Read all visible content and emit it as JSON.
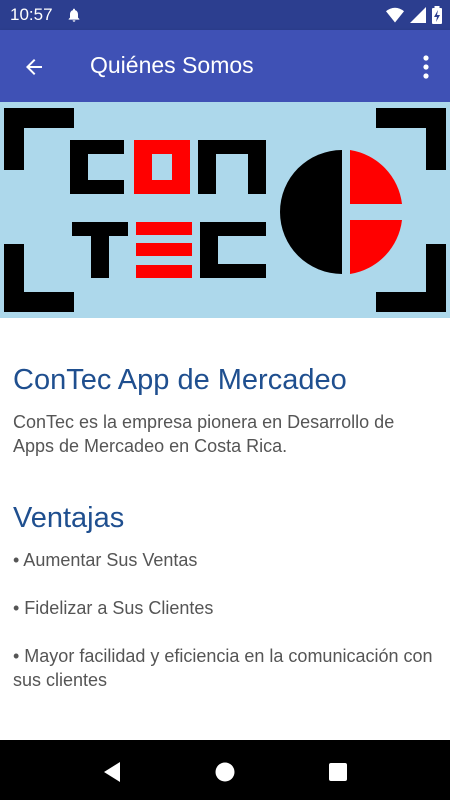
{
  "status_bar": {
    "time": "10:57",
    "icons": [
      "notification-bell-icon",
      "wifi-icon",
      "signal-icon",
      "battery-charging-icon"
    ]
  },
  "app_bar": {
    "title": "Quiénes Somos",
    "back_icon": "arrow-back-icon",
    "menu_icon": "more-vert-icon"
  },
  "banner": {
    "logo_text_top": "CON",
    "logo_text_bottom": "TEC",
    "colors": {
      "background": "#add8eb",
      "black": "#000000",
      "red": "#ff0000"
    }
  },
  "content": {
    "heading": "ConTec App de Mercadeo",
    "intro": "ConTec es la empresa pionera en Desarrollo de Apps de Mercadeo en Costa Rica.",
    "advantages_heading": "Ventajas",
    "advantages": [
      "• Aumentar Sus Ventas",
      "• Fidelizar a Sus Clientes",
      "• Mayor facilidad y eficiencia en la comunicación con sus clientes"
    ]
  },
  "theme": {
    "primary": "#3f51b5",
    "primary_dark": "#2c3e8f",
    "heading_color": "#1f4f8f",
    "text_color": "#555555"
  },
  "nav_bar": {
    "buttons": [
      "back-triangle-icon",
      "home-circle-icon",
      "recents-square-icon"
    ]
  }
}
